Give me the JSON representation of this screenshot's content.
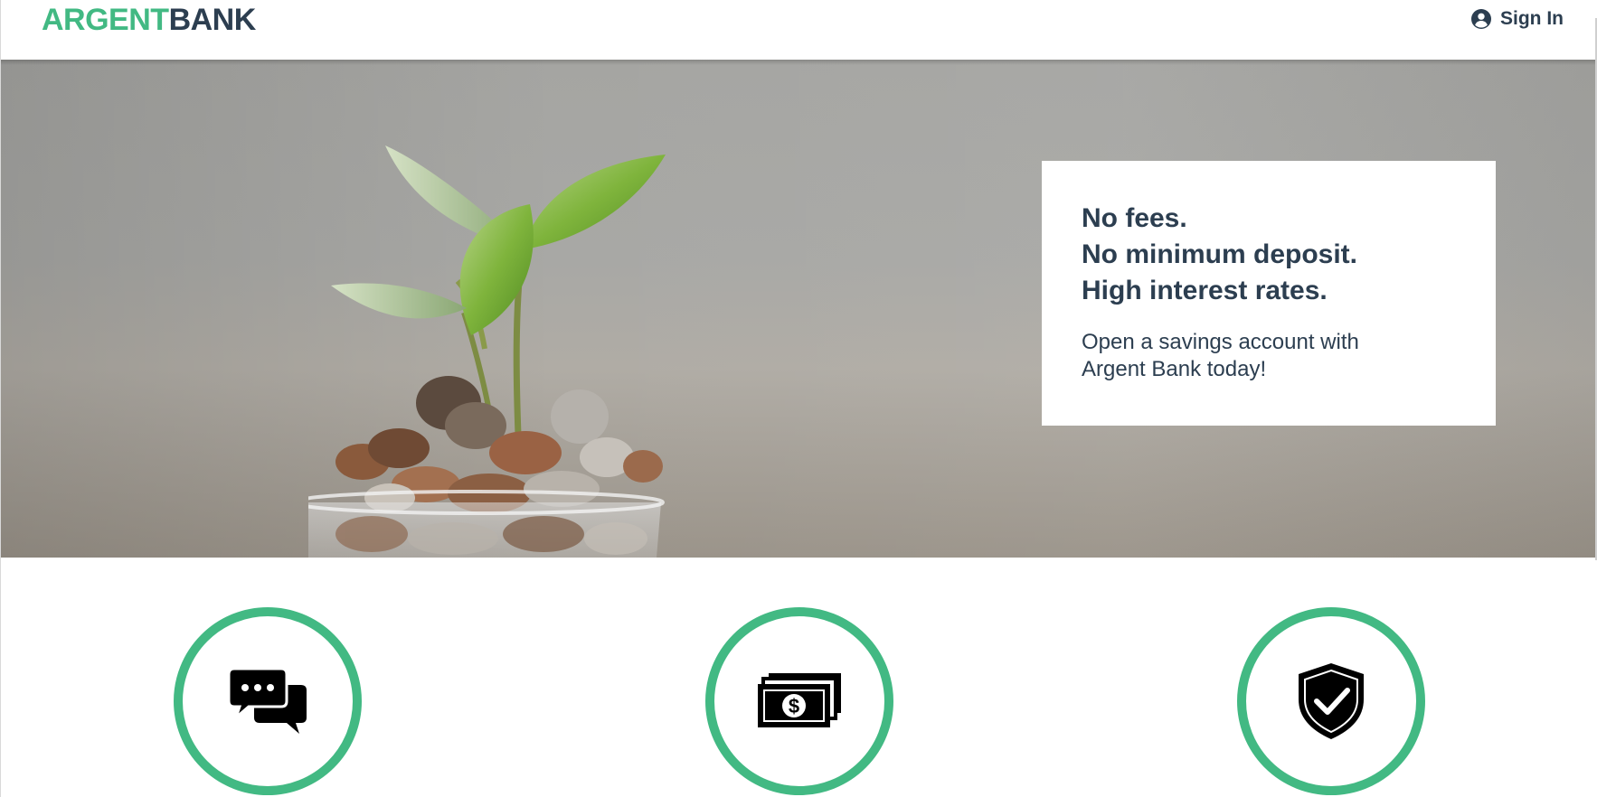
{
  "header": {
    "logo_part1": "ARGENT",
    "logo_part2": "BANK",
    "sign_in_label": "Sign In",
    "sign_in_icon": "user-circle-icon"
  },
  "hero": {
    "subtitles": [
      "No fees.",
      "No minimum deposit.",
      "High interest rates."
    ],
    "text": "Open a savings account with Argent Bank today!"
  },
  "features": [
    {
      "icon": "chat-icon"
    },
    {
      "icon": "money-icon"
    },
    {
      "icon": "security-shield-icon"
    }
  ],
  "colors": {
    "brand_green": "#42b983",
    "text_dark": "#2c3e50"
  }
}
